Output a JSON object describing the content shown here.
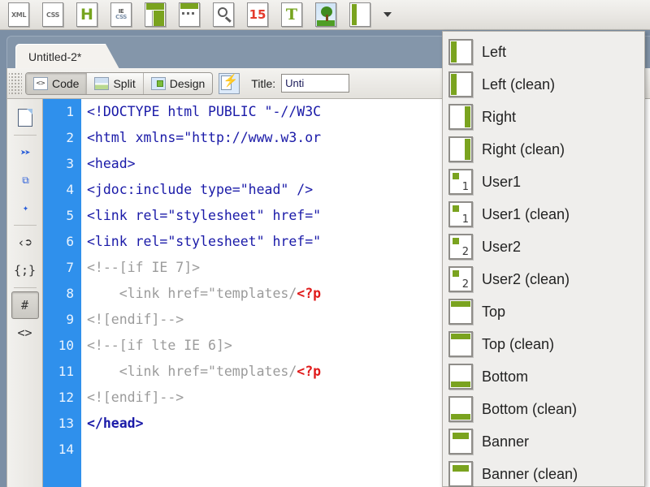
{
  "toolbar": {
    "buttons": [
      {
        "name": "xml-icon",
        "label": "XML"
      },
      {
        "name": "css-icon",
        "label": "CSS"
      },
      {
        "name": "html-icon",
        "label": "H"
      },
      {
        "name": "iecss-icon",
        "label_top": "IE",
        "label_bottom": "CSS"
      },
      {
        "name": "split-layout-icon",
        "label": ""
      },
      {
        "name": "rows-layout-icon",
        "label": ""
      },
      {
        "name": "preview-search-icon",
        "label": ""
      },
      {
        "name": "fifteen-icon",
        "label": "15"
      },
      {
        "name": "text-icon",
        "label": "T"
      },
      {
        "name": "image-icon",
        "label": ""
      },
      {
        "name": "layout-sidebar-icon",
        "label": ""
      }
    ],
    "dropdown_caret": "▼"
  },
  "document": {
    "tab_label": "Untitled-2*"
  },
  "viewbar": {
    "code_label": "Code",
    "split_label": "Split",
    "design_label": "Design",
    "live_view_label": "",
    "title_label": "Title:",
    "title_value": "Unti"
  },
  "coding_toolbar": {
    "items": [
      {
        "name": "open-documents-icon",
        "glyph": ""
      },
      {
        "name": "collapse-full-tag-icon",
        "glyph": "<>"
      },
      {
        "name": "collapse-selection-icon",
        "glyph": "⬚"
      },
      {
        "name": "expand-all-icon",
        "glyph": "✳"
      },
      {
        "name": "select-parent-tag-icon",
        "glyph": "‹⬈"
      },
      {
        "name": "balance-braces-icon",
        "glyph": "{;}"
      },
      {
        "name": "line-numbers-icon",
        "glyph": "#"
      },
      {
        "name": "highlight-invalid-code-icon",
        "glyph": "<>"
      }
    ]
  },
  "editor": {
    "line_numbers": [
      1,
      2,
      3,
      4,
      5,
      6,
      7,
      8,
      9,
      10,
      11,
      12,
      13,
      14
    ],
    "lines": [
      {
        "n": 1,
        "html": "&lt;!DOCTYPE html PUBLIC \"-//W3C"
      },
      {
        "n": 2,
        "html": "&lt;html xmlns=\"http://www.w3.or"
      },
      {
        "n": 3,
        "html": "&lt;head&gt;"
      },
      {
        "n": 4,
        "html": "&lt;jdoc:include type=\"head\" /&gt;"
      },
      {
        "n": 5,
        "html": "&lt;link rel=\"stylesheet\" href=\""
      },
      {
        "n": 6,
        "html": "&lt;link rel=\"stylesheet\" href=\""
      },
      {
        "n": 7,
        "html": "<span class=\"cmt\">&lt;!--[if IE 7]&gt;</span>"
      },
      {
        "n": 8,
        "html": "<span class=\"cmt\">    &lt;link href=\"templates/</span><span class=\"php\">&lt;?p</span>"
      },
      {
        "n": 9,
        "html": "<span class=\"cmt\">&lt;![endif]--&gt;</span>"
      },
      {
        "n": 10,
        "html": "<span class=\"cmt\">&lt;!--[if lte IE 6]&gt;</span>"
      },
      {
        "n": 11,
        "html": "<span class=\"cmt\">    &lt;link href=\"templates/</span><span class=\"php\">&lt;?p</span>"
      },
      {
        "n": 12,
        "html": "<span class=\"cmt\">&lt;![endif]--&gt;</span>"
      },
      {
        "n": 13,
        "html": "<span class=\"tagb\">&lt;/head&gt;</span>"
      },
      {
        "n": 14,
        "html": ""
      }
    ]
  },
  "menu": {
    "items": [
      {
        "label": "Left",
        "icon": "layout-left-icon",
        "variant": "left",
        "badge": ""
      },
      {
        "label": "Left (clean)",
        "icon": "layout-left-clean-icon",
        "variant": "left",
        "badge": ""
      },
      {
        "label": "Right",
        "icon": "layout-right-icon",
        "variant": "right",
        "badge": ""
      },
      {
        "label": "Right (clean)",
        "icon": "layout-right-clean-icon",
        "variant": "right",
        "badge": ""
      },
      {
        "label": "User1",
        "icon": "layout-user1-icon",
        "variant": "user",
        "badge": "1"
      },
      {
        "label": "User1 (clean)",
        "icon": "layout-user1-clean-icon",
        "variant": "user",
        "badge": "1"
      },
      {
        "label": "User2",
        "icon": "layout-user2-icon",
        "variant": "user",
        "badge": "2"
      },
      {
        "label": "User2 (clean)",
        "icon": "layout-user2-clean-icon",
        "variant": "user",
        "badge": "2"
      },
      {
        "label": "Top",
        "icon": "layout-top-icon",
        "variant": "top",
        "badge": ""
      },
      {
        "label": "Top (clean)",
        "icon": "layout-top-clean-icon",
        "variant": "top",
        "badge": ""
      },
      {
        "label": "Bottom",
        "icon": "layout-bottom-icon",
        "variant": "bottom",
        "badge": ""
      },
      {
        "label": "Bottom (clean)",
        "icon": "layout-bottom-clean-icon",
        "variant": "bottom",
        "badge": ""
      },
      {
        "label": "Banner",
        "icon": "layout-banner-icon",
        "variant": "banner",
        "badge": ""
      },
      {
        "label": "Banner (clean)",
        "icon": "layout-banner-clean-icon",
        "variant": "banner",
        "badge": ""
      }
    ]
  },
  "colors": {
    "accent_green": "#7aa31f",
    "gutter_blue": "#2f90ec",
    "code_blue": "#1a1aa8",
    "comment_gray": "#9b9b9b",
    "php_red": "#e01b1b",
    "chrome_gray": "#eceae6",
    "titlebar_blue": "#7c8fa5"
  }
}
